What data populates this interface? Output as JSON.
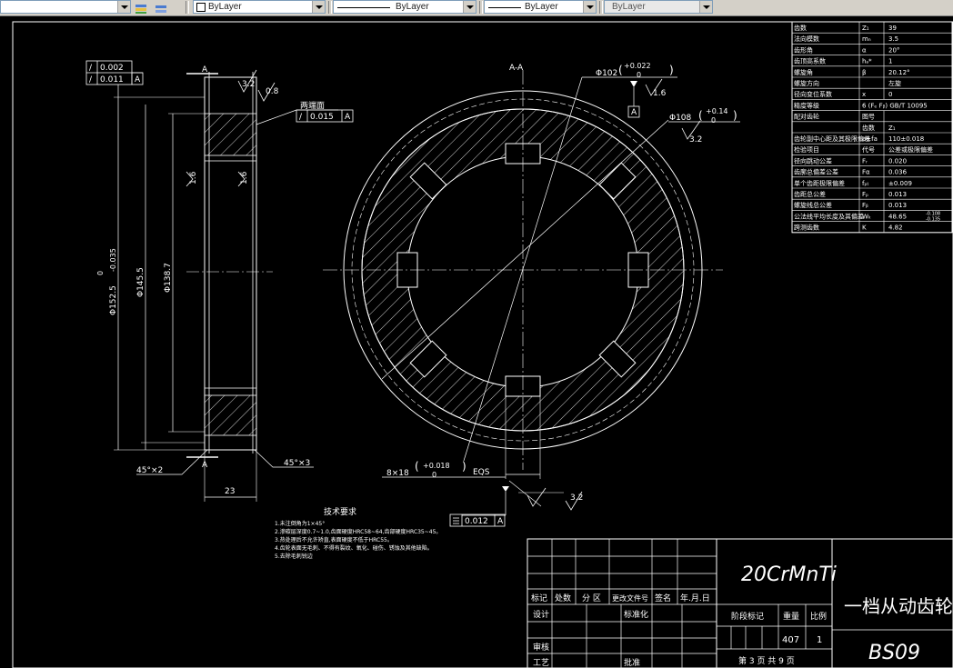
{
  "toolbar": {
    "layer_color": "ByLayer",
    "layer_linetype": "ByLayer",
    "layer_lineweight": "ByLayer",
    "layer_plotstyle": "ByLayer"
  },
  "drawing": {
    "left_view": {
      "tol_row1": "0.002",
      "tol_row2": "0.011",
      "datum_a": "A",
      "section_mark_top": "A",
      "section_mark_bottom": "A",
      "rough_top": "3.2",
      "rough_top2": "0.8",
      "face_note": "两端面",
      "face_tol": "0.015",
      "face_datum": "A",
      "rough_side1": "1.6",
      "rough_side2": "1.6",
      "dia_outer": "Φ152.5",
      "dia_outer_tol_up": "0",
      "dia_outer_tol_low": "-0.035",
      "dia_mid": "Φ145.5",
      "dia_inner": "Φ138.7",
      "chamfer_left": "45°×2",
      "chamfer_right": "45°×3",
      "width_dim": "23"
    },
    "section_view": {
      "title": "A-A",
      "dia_bore": "Φ102",
      "dia_bore_tol_up": "+0.022",
      "dia_bore_tol_low": "0",
      "rough_bore": "1.6",
      "bore_datum": "A",
      "dia_spline": "Φ108",
      "dia_spline_tol_up": "+0.14",
      "dia_spline_tol_low": "0",
      "rough_spline": "3.2",
      "slots_label": "8×18",
      "slots_tol_up": "+0.018",
      "slots_tol_low": "0",
      "slots_eqs": "EQS",
      "sym_tol": "0.012",
      "sym_datum": "A",
      "rough_slot": "3.2"
    },
    "notes": {
      "title": "技术要求",
      "lines": [
        "1.未注倒角为1×45°",
        "2.渗碳层深度0.7~1.0,齿面硬度HRC58~64,齿部硬度HRC35~45。",
        "3.热处理后不允许矫直,表面硬度不低于HRC55。",
        "4.齿轮表面无毛刺、不得有裂纹、氧化、碰伤、锈蚀及其他缺陷。",
        "5.去除毛刺锐边"
      ]
    },
    "param_table": {
      "rows": [
        [
          "齿数",
          "Z₁",
          "39"
        ],
        [
          "法向模数",
          "mₙ",
          "3.5"
        ],
        [
          "齿形角",
          "α",
          "20°"
        ],
        [
          "齿顶高系数",
          "hₐ*",
          "1"
        ],
        [
          "螺旋角",
          "β",
          "20.12°"
        ],
        [
          "螺旋方向",
          "",
          "左旋"
        ],
        [
          "径向变位系数",
          "x",
          "0"
        ],
        [
          "精度等级",
          "6 (Fₑ Fᵦ) GB/T 10095",
          ""
        ],
        [
          "配对齿轮",
          "图号",
          ""
        ],
        [
          "",
          "齿数",
          "Z₁"
        ],
        [
          "齿轮副中心距及其极限偏差",
          "a±fa",
          "110±0.018"
        ],
        [
          "检验项目",
          "代号",
          "公差或极限偏差"
        ],
        [
          "径向跳动公差",
          "Fᵣ",
          "0.020"
        ],
        [
          "齿廓总偏差公差",
          "Fα",
          "0.036"
        ],
        [
          "单个齿距极限偏差",
          "fₚₜ",
          "±0.009"
        ],
        [
          "齿距总公差",
          "Fₚ",
          "0.013"
        ],
        [
          "螺旋线总公差",
          "Fᵦ",
          "0.013"
        ],
        [
          "公法线平均长度及其偏差",
          "Wₖ",
          "48.65"
        ],
        [
          "跨测齿数",
          "K",
          "4.82"
        ]
      ],
      "wk_tol_up": "-0.108",
      "wk_tol_low": "-0.135"
    },
    "title_block": {
      "material": "20CrMnTi",
      "part_name": "一档从动齿轮",
      "drawing_no": "BS09",
      "hdr_mark": "标记",
      "hdr_count": "处数",
      "hdr_zone": "分 区",
      "hdr_docno": "更改文件号",
      "hdr_sign": "签名",
      "hdr_date": "年.月.日",
      "row_design": "设计",
      "row_std": "标准化",
      "row_check": "审核",
      "row_process": "工艺",
      "row_approve": "批准",
      "stage_mark": "阶段标记",
      "weight_label": "重量",
      "scale_label": "比例",
      "weight_value": "407",
      "scale_value": "1",
      "sheet_info": "第 3 页  共 9 页"
    }
  }
}
